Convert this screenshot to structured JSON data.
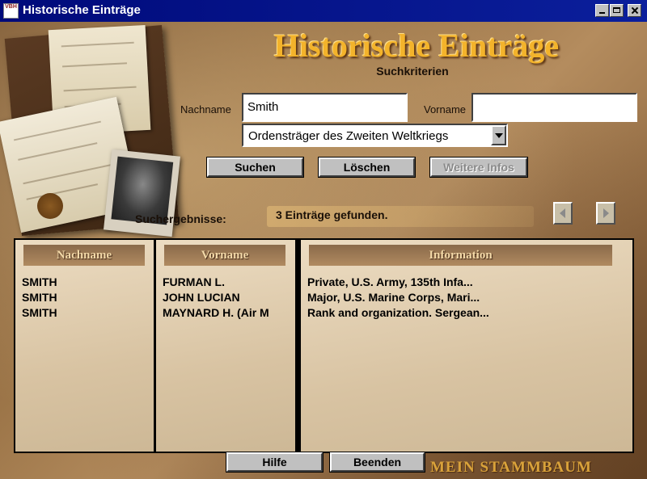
{
  "window": {
    "title": "Historische Einträge",
    "app_icon_text": "VBH"
  },
  "header": {
    "title": "Historische Einträge",
    "subtitle": "Suchkriterien"
  },
  "search": {
    "lastname_label": "Nachname",
    "lastname_value": "Smith",
    "firstname_label": "Vorname",
    "firstname_value": "",
    "category_value": "Ordensträger des Zweiten Weltkriegs"
  },
  "buttons": {
    "search": "Suchen",
    "clear": "Löschen",
    "more_info": "Weitere Infos",
    "help": "Hilfe",
    "quit": "Beenden"
  },
  "results": {
    "label": "Suchergebnisse:",
    "count_text": "3 Einträge gefunden.",
    "columns": [
      "Nachname",
      "Vorname",
      "Information"
    ],
    "rows": [
      {
        "lastname": "SMITH",
        "firstname": "FURMAN L.",
        "info": "Private, U.S. Army, 135th Infa..."
      },
      {
        "lastname": "SMITH",
        "firstname": "JOHN LUCIAN",
        "info": "Major, U.S. Marine Corps, Mari..."
      },
      {
        "lastname": "SMITH",
        "firstname": "MAYNARD H. (Air M",
        "info": "Rank and organization. Sergean..."
      }
    ]
  },
  "brand": "MEIN STAMMBAUM"
}
